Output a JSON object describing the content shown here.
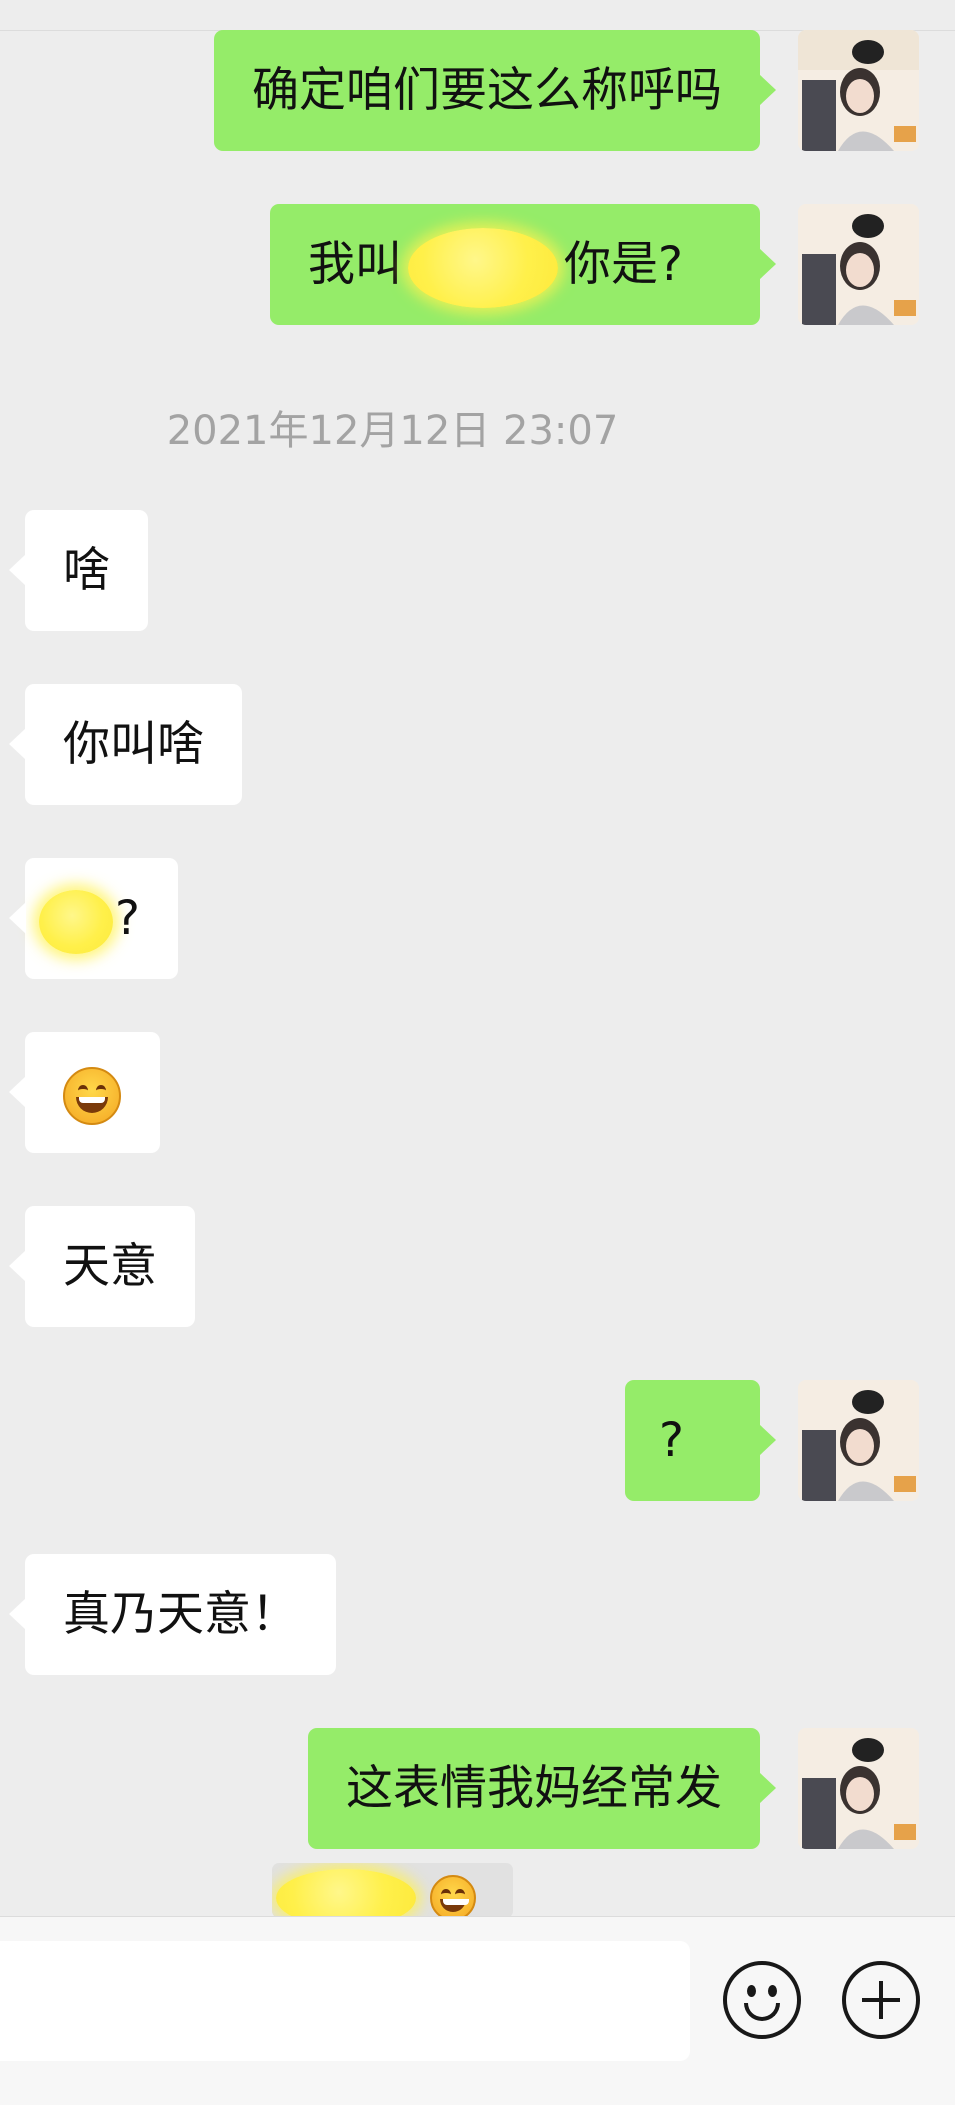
{
  "timestamp": "2021年12月12日 23:07",
  "messages": [
    {
      "from": "me",
      "text": "确定咱们要这么称呼吗"
    },
    {
      "from": "me",
      "prefix": "我叫",
      "suffix": "你是?"
    },
    {
      "from": "them",
      "text": "啥"
    },
    {
      "from": "them",
      "text": "你叫啥"
    },
    {
      "from": "them",
      "text": "?"
    },
    {
      "from": "them",
      "emoji": "grinning-face"
    },
    {
      "from": "them",
      "text": "天意"
    },
    {
      "from": "me",
      "text": "?"
    },
    {
      "from": "them",
      "text": "真乃天意！"
    },
    {
      "from": "me",
      "text": "这表情我妈经常发"
    }
  ],
  "colors": {
    "background": "#ededed",
    "my_bubble": "#95ec69",
    "their_bubble": "#ffffff",
    "timestamp_text": "#a3a3a3"
  },
  "bottom_bar": {
    "emoji_button_icon": "smiley-icon",
    "more_button_icon": "plus-icon"
  }
}
